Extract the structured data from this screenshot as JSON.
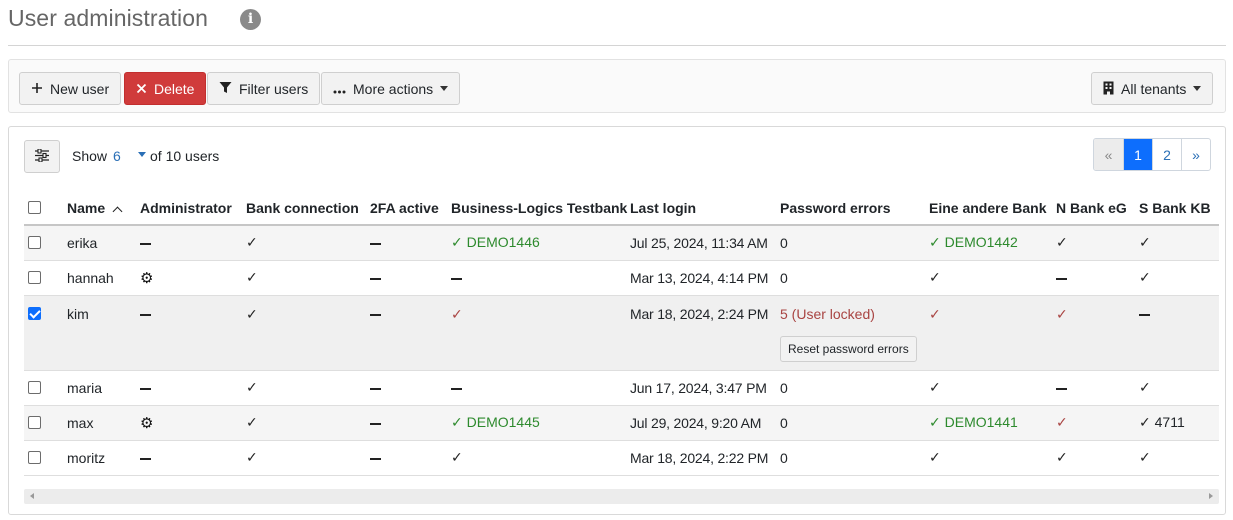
{
  "page": {
    "title": "User administration",
    "info_icon": "info-icon"
  },
  "toolbar": {
    "new_user": "New user",
    "delete": "Delete",
    "filter_users": "Filter users",
    "more_actions": "More actions",
    "tenants": "All tenants"
  },
  "list": {
    "show_label": "Show",
    "show_count": "6",
    "of_users": "of 10 users"
  },
  "pagination": {
    "prev": "«",
    "pages": [
      "1",
      "2"
    ],
    "next": "»",
    "active": "1"
  },
  "table": {
    "columns": [
      "Name",
      "Administrator",
      "Bank connection",
      "2FA active",
      "Business-Logics Testbank",
      "Last login",
      "Password errors",
      "Eine andere Bank",
      "N Bank eG",
      "S Bank KB"
    ],
    "rows": [
      {
        "name": "erika",
        "checked": false,
        "admin": "dash",
        "bank": "check",
        "twofa": "dash",
        "blt": {
          "state": "check-green",
          "text": "DEMO1446"
        },
        "last_login": "Jul 25, 2024, 11:34 AM",
        "pw_errors": "0",
        "other": {
          "state": "check-green",
          "text": "DEMO1442"
        },
        "nbank": {
          "state": "check",
          "text": ""
        },
        "sbank": {
          "state": "check",
          "text": ""
        }
      },
      {
        "name": "hannah",
        "checked": false,
        "admin": "gear",
        "bank": "check",
        "twofa": "dash",
        "blt": {
          "state": "dash",
          "text": ""
        },
        "last_login": "Mar 13, 2024, 4:14 PM",
        "pw_errors": "0",
        "other": {
          "state": "check",
          "text": ""
        },
        "nbank": {
          "state": "dash",
          "text": ""
        },
        "sbank": {
          "state": "check",
          "text": ""
        }
      },
      {
        "name": "kim",
        "checked": true,
        "admin": "dash",
        "bank": "check",
        "twofa": "dash",
        "blt": {
          "state": "check-red",
          "text": ""
        },
        "last_login": "Mar 18, 2024, 2:24 PM",
        "pw_errors": "5 (User locked)",
        "pw_locked": true,
        "reset_label": "Reset password errors",
        "other": {
          "state": "check-red",
          "text": ""
        },
        "nbank": {
          "state": "check-red",
          "text": ""
        },
        "sbank": {
          "state": "dash",
          "text": ""
        }
      },
      {
        "name": "maria",
        "checked": false,
        "admin": "dash",
        "bank": "check",
        "twofa": "dash",
        "blt": {
          "state": "dash",
          "text": ""
        },
        "last_login": "Jun 17, 2024, 3:47 PM",
        "pw_errors": "0",
        "other": {
          "state": "check",
          "text": ""
        },
        "nbank": {
          "state": "dash",
          "text": ""
        },
        "sbank": {
          "state": "check",
          "text": ""
        }
      },
      {
        "name": "max",
        "checked": false,
        "admin": "gear",
        "bank": "check",
        "twofa": "dash",
        "blt": {
          "state": "check-green",
          "text": "DEMO1445"
        },
        "last_login": "Jul 29, 2024, 9:20 AM",
        "pw_errors": "0",
        "other": {
          "state": "check-green",
          "text": "DEMO1441"
        },
        "nbank": {
          "state": "check-red",
          "text": ""
        },
        "sbank": {
          "state": "check",
          "text": "4711"
        }
      },
      {
        "name": "moritz",
        "checked": false,
        "admin": "dash",
        "bank": "check",
        "twofa": "dash",
        "blt": {
          "state": "check",
          "text": ""
        },
        "last_login": "Mar 18, 2024, 2:22 PM",
        "pw_errors": "0",
        "other": {
          "state": "check",
          "text": ""
        },
        "nbank": {
          "state": "check",
          "text": ""
        },
        "sbank": {
          "state": "check",
          "text": ""
        }
      }
    ]
  }
}
